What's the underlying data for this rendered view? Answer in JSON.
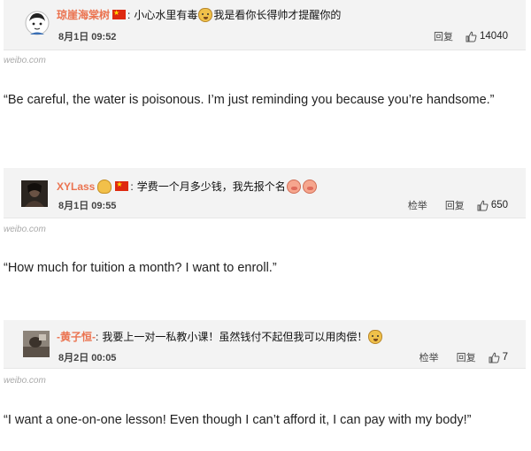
{
  "comments": [
    {
      "username": "琼崖海棠树",
      "text_before": "小心水里有毒",
      "text_after": "我是看你长得帅才提醒你的",
      "date": "8月1日 09:52",
      "report": "",
      "reply": "回复",
      "likes": "14040",
      "source": "weibo.com",
      "translation": "“Be careful, the water is poisonous. I’m just reminding you because you’re handsome.”"
    },
    {
      "username": "XYLass",
      "text_before": "学费一个月多少钱，我先报个名",
      "text_after": "",
      "date": "8月1日 09:55",
      "report": "检举",
      "reply": "回复",
      "likes": "650",
      "source": "weibo.com",
      "translation": "“How much for tuition a month? I want to enroll.”"
    },
    {
      "username": "-黄子恒-",
      "text_before": "我要上一对一私教小课！虽然钱付不起但我可以用肉偿！",
      "text_after": "",
      "date": "8月2日 00:05",
      "report": "检举",
      "reply": "回复",
      "likes": "7",
      "source": "weibo.com",
      "translation": "“I want a one-on-one lesson! Even though I can’t afford it, I can pay with my body!”"
    }
  ],
  "icons": {
    "flag": "china-flag-icon",
    "emoji_doge": "doge-emoji-icon",
    "emoji_pig": "pig-emoji-icon",
    "like": "thumbs-up-icon"
  }
}
